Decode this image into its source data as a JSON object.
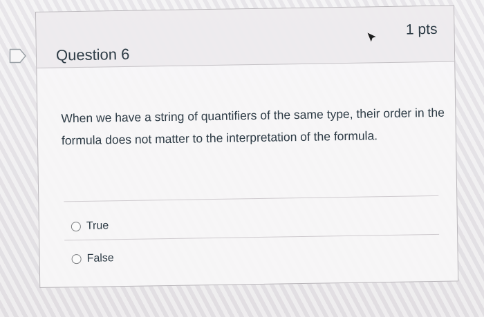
{
  "question": {
    "title": "Question 6",
    "points": "1 pts",
    "text": "When we have a string of quantifiers of the same type, their order in the formula does not matter to the interpretation of the formula.",
    "answers": [
      {
        "label": "True",
        "selected": false
      },
      {
        "label": "False",
        "selected": false
      }
    ]
  },
  "icons": {
    "flag": "flag-question-icon",
    "cursor": "mouse-cursor-icon",
    "radio": "radio-button-icon"
  },
  "colors": {
    "text": "#2d3b45",
    "border": "#b9b6ba",
    "header_bg": "#eceaec"
  }
}
